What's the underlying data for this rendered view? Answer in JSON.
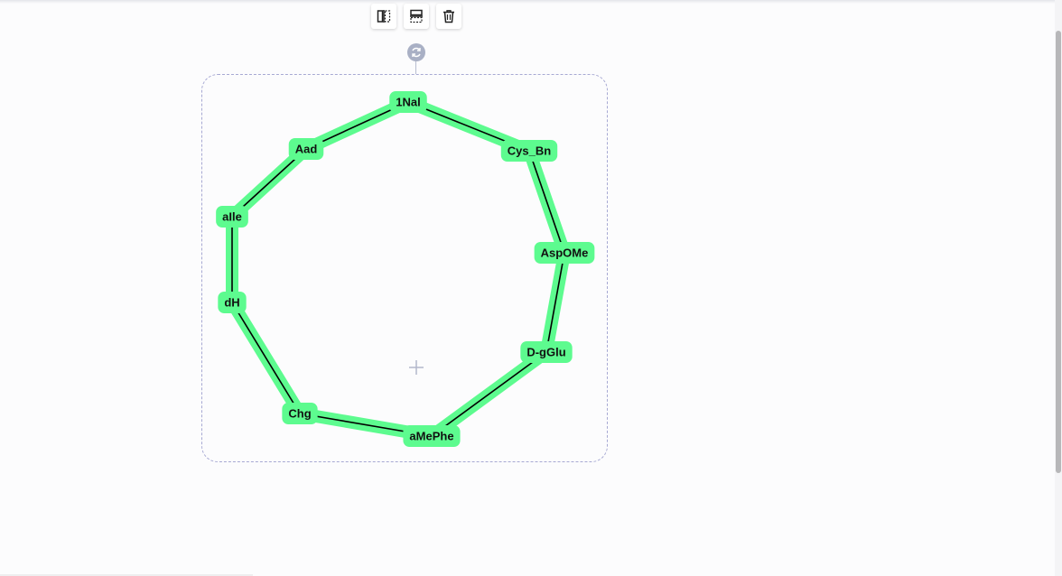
{
  "toolbar": {
    "buttons": [
      {
        "name": "flip-horizontal-button",
        "icon": "flip-horizontal-icon"
      },
      {
        "name": "flip-vertical-button",
        "icon": "flip-vertical-icon"
      },
      {
        "name": "delete-button",
        "icon": "trash-icon"
      }
    ]
  },
  "rotate_handle": {
    "icon": "rotate-icon"
  },
  "center_marker": {
    "icon": "plus-icon"
  },
  "colors": {
    "monomer_highlight": "#5dfb8f",
    "bond": "#000000",
    "selection_border": "#a7a9d3",
    "handle": "#a9b0c5"
  },
  "macromolecule": {
    "type": "cyclic-peptide",
    "monomers": [
      "1Nal",
      "Cys_Bn",
      "AspOMe",
      "D-gGlu",
      "aMePhe",
      "Chg",
      "dH",
      "aIle",
      "Aad"
    ]
  }
}
